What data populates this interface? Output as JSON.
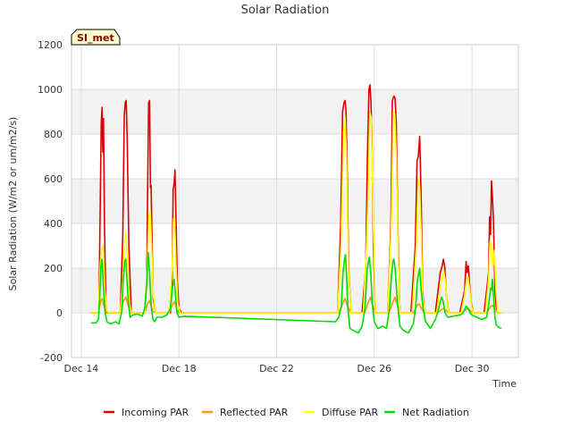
{
  "chart_data": {
    "type": "line",
    "title": "Solar Radiation",
    "xlabel": "Time",
    "ylabel": "Solar Radiation (W/m2 or um/m2/s)",
    "badge": "SI_met",
    "ylim": [
      -200,
      1200
    ],
    "yticks": [
      -200,
      0,
      200,
      400,
      600,
      800,
      1000,
      1200
    ],
    "xlim": [
      13.6,
      31.9
    ],
    "xticks": [
      {
        "label": "Dec 14",
        "day": 14
      },
      {
        "label": "Dec 18",
        "day": 18
      },
      {
        "label": "Dec 22",
        "day": 22
      },
      {
        "label": "Dec 26",
        "day": 26
      },
      {
        "label": "Dec 30",
        "day": 30
      }
    ],
    "x_unit": "day of December",
    "grid": true,
    "legend_position": "bottom",
    "background_bands": true,
    "series": [
      {
        "name": "Incoming PAR",
        "color": "#dd0000",
        "x": [
          14.4,
          14.72,
          14.78,
          14.82,
          14.85,
          14.88,
          14.91,
          14.95,
          15.0,
          15.05,
          15.1,
          15.35,
          15.6,
          15.7,
          15.76,
          15.8,
          15.84,
          15.88,
          15.95,
          16.05,
          16.15,
          16.4,
          16.6,
          16.68,
          16.72,
          16.76,
          16.8,
          16.83,
          16.86,
          16.9,
          16.95,
          17.05,
          17.15,
          17.4,
          17.65,
          17.72,
          17.76,
          17.8,
          17.84,
          17.88,
          17.93,
          18.0,
          18.1,
          18.2,
          24.5,
          24.62,
          24.7,
          24.76,
          24.8,
          24.84,
          24.88,
          24.95,
          25.05,
          25.1,
          25.5,
          25.65,
          25.72,
          25.78,
          25.82,
          25.86,
          25.9,
          25.96,
          26.05,
          26.1,
          26.55,
          26.68,
          26.74,
          26.8,
          26.85,
          26.9,
          26.96,
          27.05,
          27.1,
          27.5,
          27.68,
          27.75,
          27.8,
          27.86,
          27.92,
          27.98,
          28.05,
          28.1,
          28.5,
          28.7,
          28.78,
          28.83,
          28.88,
          28.95,
          29.05,
          29.1,
          29.5,
          29.7,
          29.76,
          29.8,
          29.85,
          29.9,
          29.96,
          30.05,
          30.15,
          30.5,
          30.68,
          30.72,
          30.76,
          30.8,
          30.84,
          30.88,
          30.94,
          31.0,
          31.05,
          31.2
        ],
        "y": [
          0,
          0,
          500,
          850,
          920,
          720,
          870,
          400,
          60,
          0,
          0,
          0,
          0,
          350,
          880,
          940,
          950,
          780,
          300,
          0,
          0,
          0,
          0,
          150,
          560,
          940,
          950,
          560,
          570,
          300,
          60,
          0,
          0,
          0,
          0,
          150,
          550,
          580,
          640,
          430,
          150,
          20,
          0,
          0,
          0,
          380,
          900,
          940,
          950,
          910,
          700,
          200,
          0,
          0,
          0,
          200,
          700,
          1000,
          1020,
          950,
          800,
          300,
          0,
          0,
          0,
          400,
          950,
          970,
          960,
          850,
          400,
          0,
          0,
          0,
          300,
          680,
          700,
          790,
          500,
          100,
          0,
          0,
          0,
          180,
          210,
          240,
          210,
          80,
          0,
          0,
          0,
          100,
          230,
          180,
          210,
          130,
          50,
          0,
          0,
          0,
          180,
          430,
          350,
          590,
          520,
          410,
          100,
          20,
          0,
          0
        ]
      },
      {
        "name": "Reflected PAR",
        "color": "#ff9900",
        "x": [
          14.4,
          14.7,
          14.8,
          14.86,
          14.9,
          15.0,
          15.1,
          15.6,
          15.72,
          15.82,
          15.9,
          16.0,
          16.1,
          16.6,
          16.72,
          16.8,
          16.86,
          16.95,
          17.05,
          17.6,
          17.75,
          17.82,
          17.9,
          18.0,
          24.55,
          24.7,
          24.8,
          24.9,
          25.05,
          25.6,
          25.75,
          25.84,
          25.94,
          26.05,
          26.6,
          26.74,
          26.84,
          26.94,
          27.05,
          27.6,
          27.76,
          27.84,
          27.95,
          28.05,
          28.6,
          28.76,
          28.84,
          28.95,
          29.05,
          29.6,
          29.76,
          29.84,
          29.95,
          30.05,
          30.6,
          30.74,
          30.84,
          30.94,
          31.05,
          31.2
        ],
        "y": [
          0,
          0,
          55,
          65,
          40,
          5,
          0,
          0,
          50,
          70,
          40,
          5,
          0,
          0,
          40,
          55,
          30,
          5,
          0,
          0,
          40,
          50,
          20,
          0,
          0,
          40,
          65,
          30,
          0,
          0,
          45,
          70,
          30,
          0,
          0,
          40,
          70,
          35,
          0,
          0,
          35,
          40,
          15,
          0,
          0,
          15,
          20,
          8,
          0,
          0,
          15,
          20,
          8,
          0,
          0,
          25,
          35,
          15,
          0,
          0
        ]
      },
      {
        "name": "Diffuse PAR",
        "color": "#ffff00",
        "x": [
          14.4,
          14.7,
          14.78,
          14.84,
          14.9,
          14.96,
          15.05,
          15.15,
          15.6,
          15.7,
          15.78,
          15.83,
          15.9,
          15.98,
          16.05,
          16.15,
          16.6,
          16.7,
          16.76,
          16.82,
          16.88,
          16.95,
          17.05,
          17.6,
          17.72,
          17.78,
          17.82,
          17.88,
          17.95,
          18.05,
          24.5,
          24.64,
          24.74,
          24.8,
          24.86,
          24.94,
          25.05,
          25.55,
          25.68,
          25.76,
          25.82,
          25.88,
          25.96,
          26.05,
          26.55,
          26.7,
          26.78,
          26.84,
          26.9,
          26.98,
          27.05,
          27.55,
          27.72,
          27.8,
          27.86,
          27.92,
          27.98,
          28.05,
          28.55,
          28.7,
          28.78,
          28.84,
          28.9,
          28.98,
          29.05,
          29.55,
          29.7,
          29.78,
          29.84,
          29.9,
          29.98,
          30.05,
          30.55,
          30.68,
          30.74,
          30.8,
          30.86,
          30.92,
          30.98,
          31.05,
          31.2
        ],
        "y": [
          0,
          0,
          220,
          290,
          300,
          100,
          10,
          0,
          0,
          150,
          330,
          360,
          200,
          40,
          0,
          0,
          0,
          200,
          410,
          460,
          300,
          80,
          0,
          0,
          200,
          420,
          430,
          220,
          40,
          0,
          0,
          300,
          800,
          880,
          700,
          200,
          0,
          0,
          300,
          580,
          900,
          870,
          400,
          0,
          0,
          400,
          900,
          890,
          700,
          250,
          0,
          0,
          300,
          600,
          560,
          350,
          80,
          0,
          0,
          120,
          160,
          190,
          150,
          50,
          0,
          0,
          80,
          150,
          160,
          110,
          30,
          0,
          0,
          150,
          320,
          300,
          200,
          280,
          100,
          0,
          0
        ]
      },
      {
        "name": "Net Radiation",
        "color": "#00dd00",
        "x": [
          14.4,
          14.6,
          14.7,
          14.76,
          14.8,
          14.84,
          14.88,
          14.92,
          14.98,
          15.05,
          15.2,
          15.4,
          15.55,
          15.66,
          15.72,
          15.78,
          15.82,
          15.86,
          15.92,
          16.0,
          16.1,
          16.3,
          16.5,
          16.6,
          16.68,
          16.74,
          16.8,
          16.84,
          16.88,
          16.94,
          17.0,
          17.1,
          17.3,
          17.5,
          17.65,
          17.74,
          17.8,
          17.86,
          17.92,
          18.0,
          18.2,
          24.4,
          24.55,
          24.65,
          24.72,
          24.78,
          24.82,
          24.86,
          24.92,
          25.0,
          25.15,
          25.35,
          25.5,
          25.62,
          25.7,
          25.76,
          25.8,
          25.86,
          25.92,
          26.0,
          26.15,
          26.35,
          26.5,
          26.62,
          26.7,
          26.76,
          26.8,
          26.86,
          26.94,
          27.05,
          27.2,
          27.4,
          27.6,
          27.7,
          27.76,
          27.82,
          27.86,
          27.92,
          28.0,
          28.1,
          28.3,
          28.5,
          28.62,
          28.7,
          28.76,
          28.82,
          28.9,
          29.0,
          29.2,
          29.5,
          29.6,
          29.68,
          29.76,
          29.84,
          29.92,
          30.0,
          30.2,
          30.4,
          30.6,
          30.7,
          30.76,
          30.8,
          30.84,
          30.88,
          30.94,
          31.0,
          31.1,
          31.2
        ],
        "y": [
          -45,
          -45,
          -30,
          80,
          200,
          240,
          180,
          90,
          0,
          -40,
          -50,
          -40,
          -50,
          10,
          150,
          230,
          240,
          170,
          60,
          -20,
          -10,
          -5,
          -15,
          20,
          130,
          270,
          180,
          80,
          10,
          -30,
          -40,
          -20,
          -20,
          -10,
          20,
          120,
          150,
          80,
          0,
          -20,
          -15,
          -40,
          -20,
          30,
          180,
          240,
          260,
          170,
          20,
          -70,
          -80,
          -90,
          -60,
          20,
          180,
          230,
          250,
          170,
          40,
          -40,
          -70,
          -60,
          -70,
          20,
          160,
          230,
          240,
          190,
          50,
          -60,
          -80,
          -90,
          -50,
          30,
          140,
          180,
          200,
          100,
          20,
          -40,
          -70,
          -30,
          10,
          50,
          70,
          50,
          0,
          -20,
          -15,
          -10,
          -5,
          10,
          30,
          20,
          0,
          -10,
          -20,
          -30,
          -20,
          50,
          110,
          100,
          150,
          80,
          -20,
          -55,
          -65,
          -70
        ]
      }
    ]
  }
}
